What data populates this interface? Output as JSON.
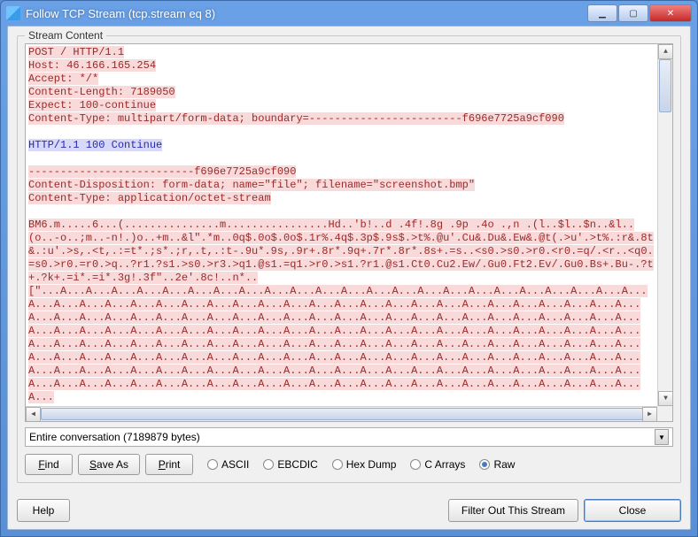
{
  "window": {
    "title": "Follow TCP Stream (tcp.stream eq 8)"
  },
  "fieldset_label": "Stream Content",
  "stream": {
    "request": "POST / HTTP/1.1\nHost: 46.166.165.254\nAccept: */*\nContent-Length: 7189050\nExpect: 100-continue\nContent-Type: multipart/form-data; boundary=------------------------f696e7725a9cf090\n\n",
    "response": "HTTP/1.1 100 Continue\n",
    "request2": "\n--------------------------f696e7725a9cf090\nContent-Disposition: form-data; name=\"file\"; filename=\"screenshot.bmp\"\nContent-Type: application/octet-stream\n\nBM6.m.....6...(...............m................Hd..'b!..d .4f!.8g .9p .4o .,n .(l..$l..$n..&l..(o..-o..;m..-n!.)o..+m..&l\".*m..0q$.0o$.0o$.1r%.4q$.3p$.9s$.>t%.@u'.Cu&.Du&.Ew&.@t(.>u'.>t%.:r&.8t&.:u'.>s,.<t,.:=t*.;s*.;r,.t,.:t-.9u*.9s,.9r+.8r*.9q+.7r*.8r*.8s+.=s..<s0.>s0.>r0.<r0.=q/.<r..<q0.=s0.>r0.=r0.>q..?r1.?s1.>s0.>r3.>q1.@s1.=q1.>r0.>s1.?r1.@s1.Ct0.Cu2.Ew/.Gu0.Ft2.Ev/.Gu0.Bs+.Bu-.?t+.?k+.=i*.=i*.3g!.3f\"..2e'.8c!..n*..",
    "request3": "\n[\"...A...A...A...A...A...A...A...A...A...A...A...A...A...A...A...A...A...A...A...A...A...A...A...A...A...A...A...A...A...A...A...A...A...A...A...A...A...A...A...A...A...A...A...A...A...A...A...A...A...A...A...A...A...A...A...A...A...A...A...A...A...A...A...A...A...A...A...A...A...A...A...A...A...A...A...A...A...A...A...A...A...A...A...A...A...A...A...A...A...A...A...A...A...A...A...A...A...A...A...A...A...A...A...A...A...A...A...A...A...A...A...A...A...A...A...A...A...A...A...A...A...A...A...A...A...A...A...A...A...A...A...A...A...A...A...A...A...A...A...A...A...A...A...A...A...A...A...A...A...A...A...A...A...A...A...A...A...A...A...A...A...A...A...A...A...A...A...A...A...A...A...A...A...A...A...A...A...A...A...A...A...A...A...A...A...A...A...A...A...A...A...A..."
  },
  "conversation_select": "Entire conversation (7189879 bytes)",
  "toolbar": {
    "find": "Find",
    "save_as": "Save As",
    "print": "Print",
    "radio_ascii": "ASCII",
    "radio_ebcdic": "EBCDIC",
    "radio_hexdump": "Hex Dump",
    "radio_carrays": "C Arrays",
    "radio_raw": "Raw"
  },
  "bottom": {
    "help": "Help",
    "filter_out": "Filter Out This Stream",
    "close": "Close"
  }
}
